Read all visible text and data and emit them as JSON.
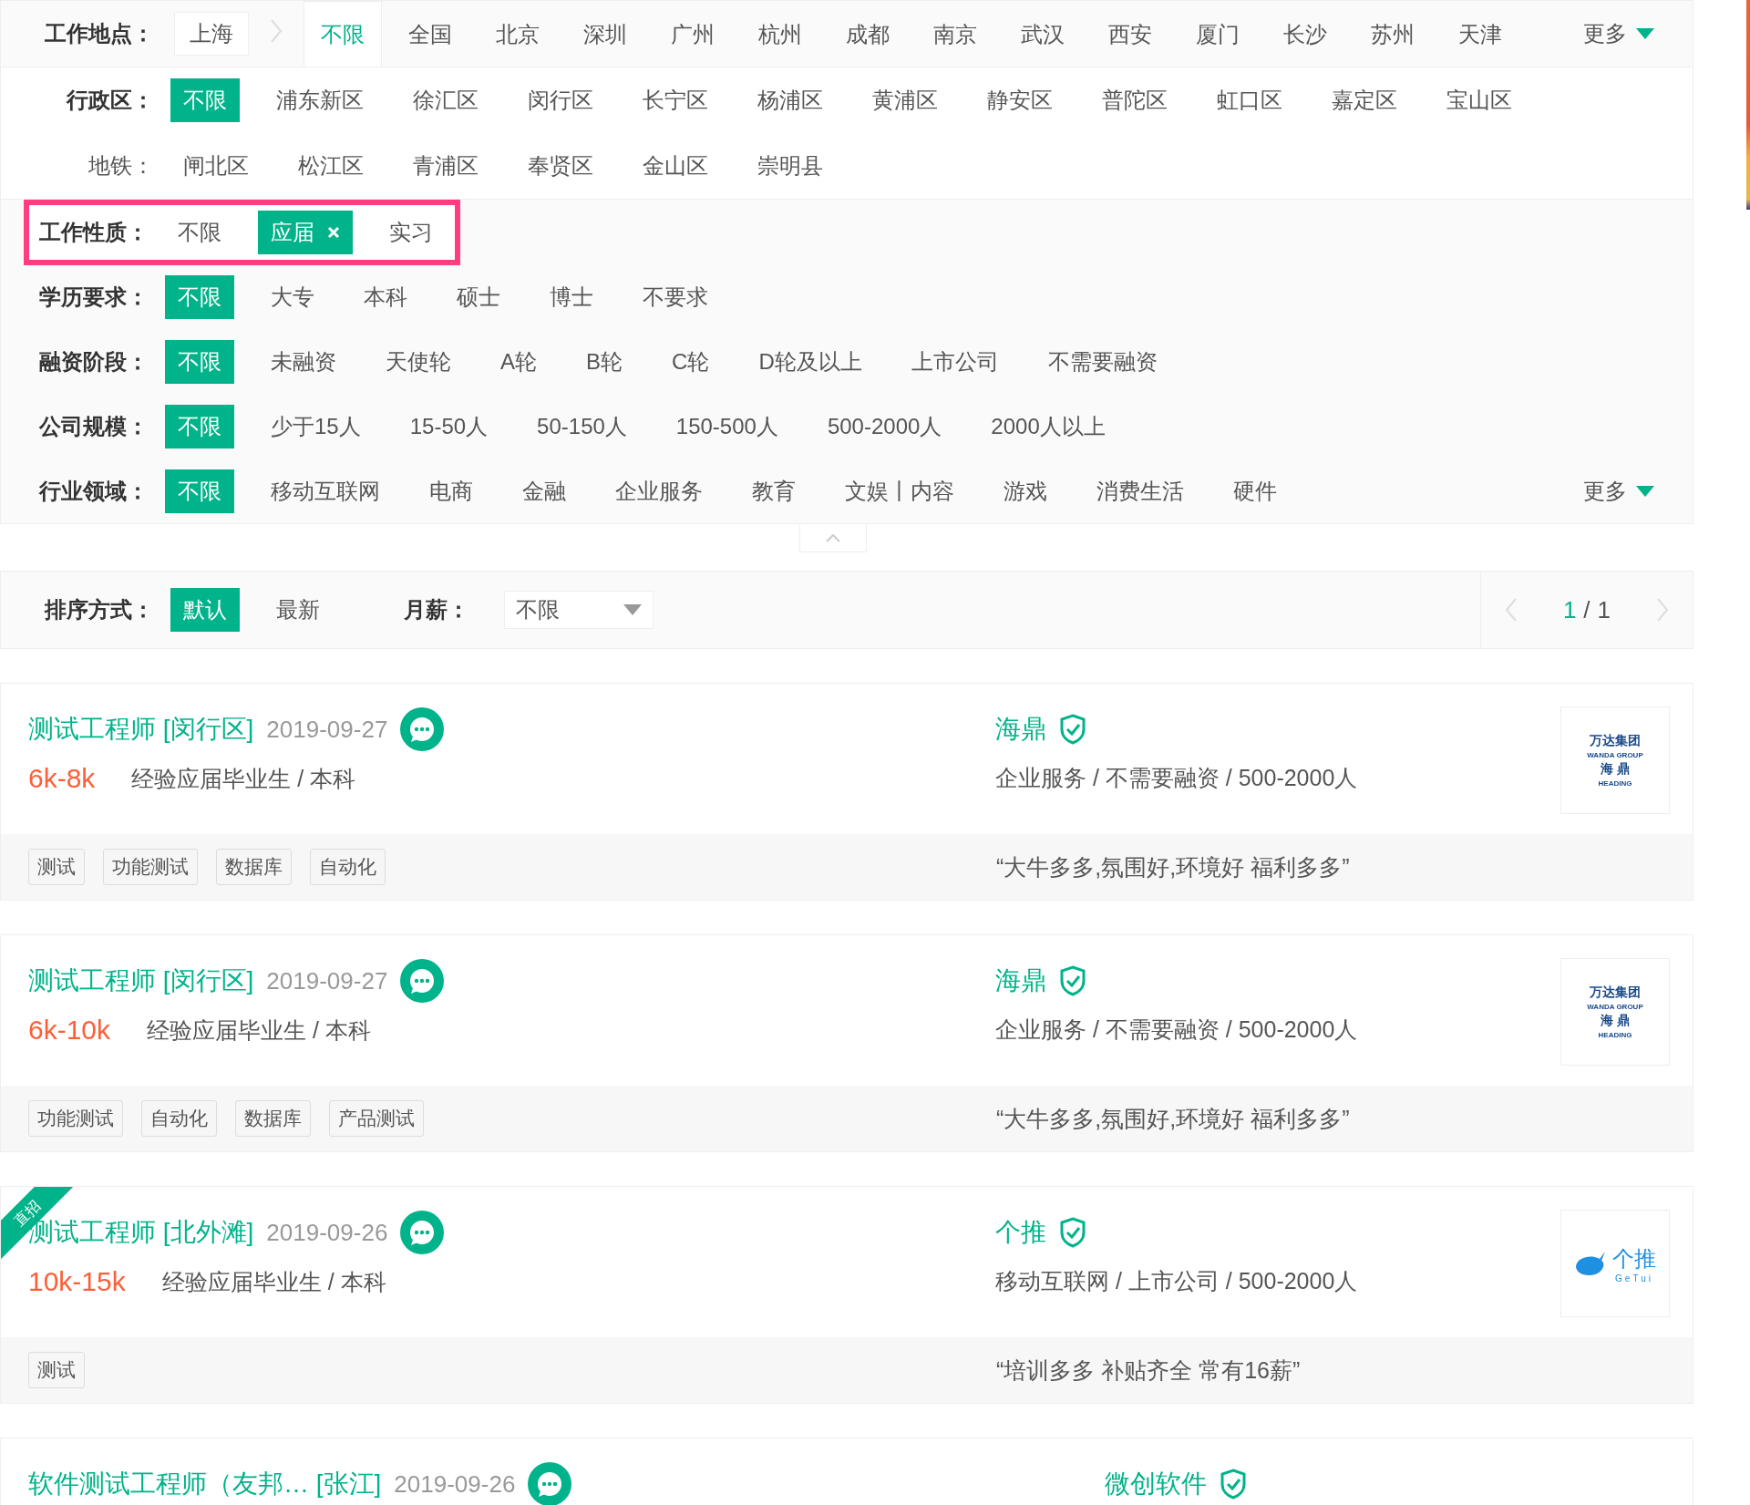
{
  "filters": [
    {
      "label": "工作地点：",
      "kind": "tabs",
      "current": "上海",
      "more": "更多",
      "options": [
        {
          "label": "不限",
          "selected": true
        },
        {
          "label": "全国",
          "selected": false
        },
        {
          "label": "北京",
          "selected": false
        },
        {
          "label": "深圳",
          "selected": false
        },
        {
          "label": "广州",
          "selected": false
        },
        {
          "label": "杭州",
          "selected": false
        },
        {
          "label": "成都",
          "selected": false
        },
        {
          "label": "南京",
          "selected": false
        },
        {
          "label": "武汉",
          "selected": false
        },
        {
          "label": "西安",
          "selected": false
        },
        {
          "label": "厦门",
          "selected": false
        },
        {
          "label": "长沙",
          "selected": false
        },
        {
          "label": "苏州",
          "selected": false
        },
        {
          "label": "天津",
          "selected": false
        }
      ],
      "sub_filters": [
        {
          "label": "行政区：",
          "selected": true,
          "options": [
            {
              "label": "不限",
              "selected": true
            },
            {
              "label": "浦东新区",
              "selected": false
            },
            {
              "label": "徐汇区",
              "selected": false
            },
            {
              "label": "闵行区",
              "selected": false
            },
            {
              "label": "长宁区",
              "selected": false
            },
            {
              "label": "杨浦区",
              "selected": false
            },
            {
              "label": "黄浦区",
              "selected": false
            },
            {
              "label": "静安区",
              "selected": false
            },
            {
              "label": "普陀区",
              "selected": false
            },
            {
              "label": "虹口区",
              "selected": false
            },
            {
              "label": "嘉定区",
              "selected": false
            },
            {
              "label": "宝山区",
              "selected": false
            }
          ]
        },
        {
          "label": "地铁：",
          "selected": false,
          "options": [
            {
              "label": "闸北区",
              "selected": false
            },
            {
              "label": "松江区",
              "selected": false
            },
            {
              "label": "青浦区",
              "selected": false
            },
            {
              "label": "奉贤区",
              "selected": false
            },
            {
              "label": "金山区",
              "selected": false
            },
            {
              "label": "崇明县",
              "selected": false
            }
          ]
        }
      ]
    },
    {
      "label": "工作性质：",
      "kind": "closable",
      "highlighted": true,
      "options": [
        {
          "label": "不限",
          "selected": false
        },
        {
          "label": "应届",
          "selected": true
        },
        {
          "label": "实习",
          "selected": false
        }
      ]
    },
    {
      "label": "学历要求：",
      "kind": "pills",
      "highlighted": false,
      "options": [
        {
          "label": "不限",
          "selected": true
        },
        {
          "label": "大专",
          "selected": false
        },
        {
          "label": "本科",
          "selected": false
        },
        {
          "label": "硕士",
          "selected": false
        },
        {
          "label": "博士",
          "selected": false
        },
        {
          "label": "不要求",
          "selected": false
        }
      ]
    },
    {
      "label": "融资阶段：",
      "kind": "pills",
      "highlighted": false,
      "options": [
        {
          "label": "不限",
          "selected": true
        },
        {
          "label": "未融资",
          "selected": false
        },
        {
          "label": "天使轮",
          "selected": false
        },
        {
          "label": "A轮",
          "selected": false
        },
        {
          "label": "B轮",
          "selected": false
        },
        {
          "label": "C轮",
          "selected": false
        },
        {
          "label": "D轮及以上",
          "selected": false
        },
        {
          "label": "上市公司",
          "selected": false
        },
        {
          "label": "不需要融资",
          "selected": false
        }
      ]
    },
    {
      "label": "公司规模：",
      "kind": "pills",
      "highlighted": false,
      "options": [
        {
          "label": "不限",
          "selected": true
        },
        {
          "label": "少于15人",
          "selected": false
        },
        {
          "label": "15-50人",
          "selected": false
        },
        {
          "label": "50-150人",
          "selected": false
        },
        {
          "label": "150-500人",
          "selected": false
        },
        {
          "label": "500-2000人",
          "selected": false
        },
        {
          "label": "2000人以上",
          "selected": false
        }
      ]
    },
    {
      "label": "行业领域：",
      "kind": "pills",
      "highlighted": false,
      "more": "更多",
      "options": [
        {
          "label": "不限",
          "selected": true
        },
        {
          "label": "移动互联网",
          "selected": false
        },
        {
          "label": "电商",
          "selected": false
        },
        {
          "label": "金融",
          "selected": false
        },
        {
          "label": "企业服务",
          "selected": false
        },
        {
          "label": "教育",
          "selected": false
        },
        {
          "label": "文娱丨内容",
          "selected": false
        },
        {
          "label": "游戏",
          "selected": false
        },
        {
          "label": "消费生活",
          "selected": false
        },
        {
          "label": "硬件",
          "selected": false
        }
      ]
    }
  ],
  "sort_bar": {
    "label": "排序方式：",
    "options": [
      {
        "label": "默认",
        "selected": true
      },
      {
        "label": "最新",
        "selected": false
      }
    ],
    "salary_label": "月薪：",
    "salary_value": "不限",
    "page_current": "1",
    "page_separator": "/",
    "page_total": "1"
  },
  "jobs": [
    {
      "title": "测试工程师 [闵行区]",
      "date": "2019-09-27",
      "salary": "6k-8k",
      "requirement": "经验应届毕业生 / 本科",
      "company": "海鼎",
      "company_info": "企业服务 / 不需要融资 / 500-2000人",
      "logo": {
        "kind": "wanda",
        "lines": [
          "万达集团",
          "WANDA GROUP",
          "海 鼎",
          "HEADING"
        ]
      },
      "tags": [
        "测试",
        "功能测试",
        "数据库",
        "自动化"
      ],
      "quote": "“大牛多多,氛围好,环境好 福利多多”"
    },
    {
      "title": "测试工程师 [闵行区]",
      "date": "2019-09-27",
      "salary": "6k-10k",
      "requirement": "经验应届毕业生 / 本科",
      "company": "海鼎",
      "company_info": "企业服务 / 不需要融资 / 500-2000人",
      "logo": {
        "kind": "wanda",
        "lines": [
          "万达集团",
          "WANDA GROUP",
          "海 鼎",
          "HEADING"
        ]
      },
      "tags": [
        "功能测试",
        "自动化",
        "数据库",
        "产品测试"
      ],
      "quote": "“大牛多多,氛围好,环境好 福利多多”"
    },
    {
      "title": "测试工程师 [北外滩]",
      "date": "2019-09-26",
      "badge": "直招",
      "salary": "10k-15k",
      "requirement": "经验应届毕业生 / 本科",
      "company": "个推",
      "company_info": "移动互联网 / 上市公司 / 500-2000人",
      "logo": {
        "kind": "getui",
        "lines": [
          "个推",
          "GeTui"
        ]
      },
      "tags": [
        "测试"
      ],
      "quote": "“培训多多 补贴齐全 常有16薪”"
    },
    {
      "title": "软件测试工程师（友邦… [张江]",
      "date": "2019-09-26",
      "company": "微创软件"
    }
  ]
}
